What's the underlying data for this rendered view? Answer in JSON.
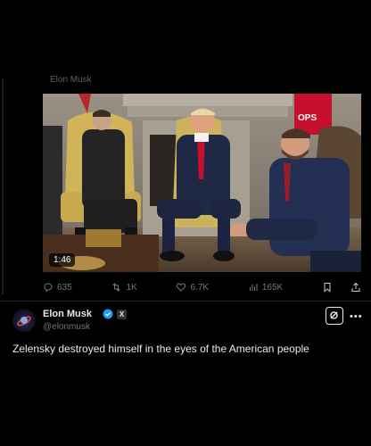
{
  "quoted_post": {
    "username": "Elon Musk",
    "video": {
      "duration": "1:46",
      "flag_text": "OPS"
    },
    "stats": {
      "replies": "635",
      "reposts": "1K",
      "likes": "6.7K",
      "views": "165K"
    }
  },
  "post": {
    "author_name": "Elon Musk",
    "handle": "@elonmusk",
    "x_badge": "X",
    "text": "Zelensky destroyed himself in the eyes of the American people"
  },
  "icons": [
    "reply-icon",
    "repost-icon",
    "like-icon",
    "views-icon",
    "bookmark-icon",
    "share-icon",
    "verified-icon",
    "grok-icon",
    "more-icon"
  ],
  "colors": {
    "background": "#000000",
    "text_primary": "#e7e9ea",
    "text_secondary": "#71767b",
    "verified": "#1d9bf0",
    "flag_red": "#c8102e"
  }
}
